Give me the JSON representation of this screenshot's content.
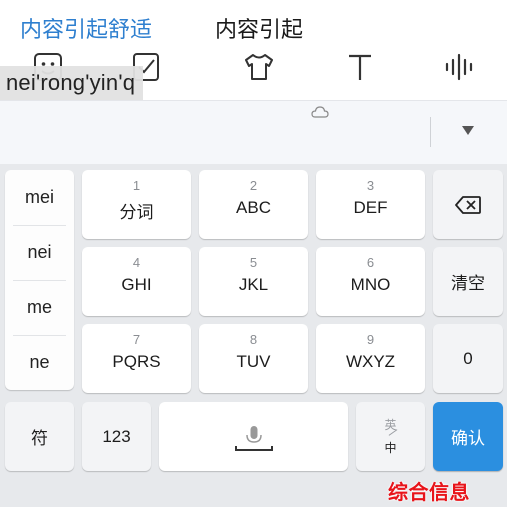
{
  "toolbar": {
    "icons": [
      "emoji-icon",
      "clipboard-check-icon",
      "shirt-icon",
      "text-icon",
      "voice-wave-icon"
    ]
  },
  "composing": {
    "text": "nei'rong'yin'q"
  },
  "candidates": {
    "first": "内容引起舒适",
    "second": "内容引起"
  },
  "side_list": [
    "mei",
    "nei",
    "me",
    "ne"
  ],
  "keys": {
    "k1": {
      "num": "1",
      "label": "分词"
    },
    "k2": {
      "num": "2",
      "label": "ABC"
    },
    "k3": {
      "num": "3",
      "label": "DEF"
    },
    "k4": {
      "num": "4",
      "label": "GHI"
    },
    "k5": {
      "num": "5",
      "label": "JKL"
    },
    "k6": {
      "num": "6",
      "label": "MNO"
    },
    "k7": {
      "num": "7",
      "label": "PQRS"
    },
    "k8": {
      "num": "8",
      "label": "TUV"
    },
    "k9": {
      "num": "9",
      "label": "WXYZ"
    },
    "clear": "清空",
    "zero": "0",
    "symbol": "符",
    "num123": "123",
    "lang_top": "英",
    "lang_bottom": "中",
    "confirm": "确认"
  },
  "watermark": "综合信息",
  "colors": {
    "accent": "#2e7fcf",
    "confirm": "#2b8fe0",
    "watermark": "#e8141a",
    "keyboard_bg": "#e7e9ec"
  }
}
